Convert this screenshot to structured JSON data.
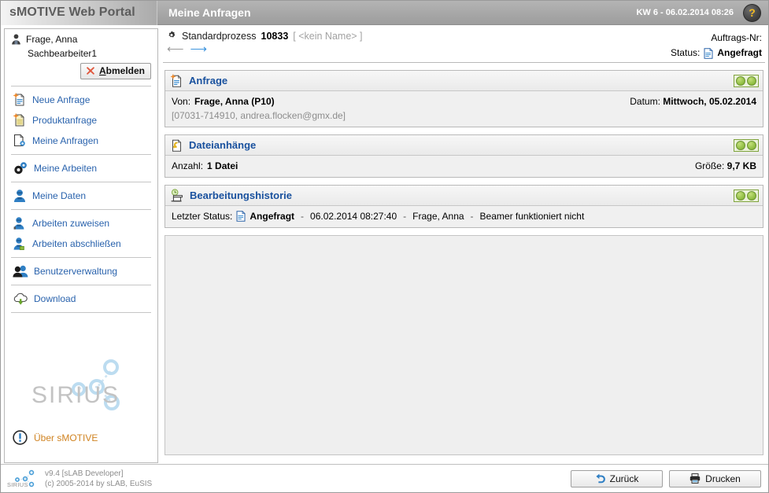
{
  "topbar": {
    "brand": "sMOTIVE Web Portal",
    "page_title": "Meine Anfragen",
    "clock": "KW 6 - 06.02.2014 08:26",
    "help_label": "?"
  },
  "sidebar": {
    "user_name": "Frage, Anna",
    "user_role": "Sachbearbeiter1",
    "logout_label": "Abmelden",
    "logout_accel": "A",
    "logout_rest": "bmelden",
    "items": [
      {
        "label": "Neue Anfrage",
        "icon": "new-document-icon"
      },
      {
        "label": "Produktanfrage",
        "icon": "product-request-icon"
      },
      {
        "label": "Meine Anfragen",
        "icon": "my-requests-icon"
      },
      {
        "label": "Meine Arbeiten",
        "icon": "gears-icon"
      },
      {
        "label": "Meine Daten",
        "icon": "user-data-icon"
      },
      {
        "label": "Arbeiten zuweisen",
        "icon": "assign-work-icon"
      },
      {
        "label": "Arbeiten abschließen",
        "icon": "complete-work-icon"
      },
      {
        "label": "Benutzerverwaltung",
        "icon": "users-icon"
      },
      {
        "label": "Download",
        "icon": "cloud-download-icon"
      }
    ],
    "watermark_text": "SIRIUS",
    "about_label": "Über sMOTIVE"
  },
  "process": {
    "type_label": "Standardprozess",
    "number": "10833",
    "name_placeholder": "[ <kein Name> ]",
    "auftrags_label": "Auftrags-Nr:",
    "auftrags_value": "",
    "status_label": "Status:",
    "status_value": "Angefragt"
  },
  "panels": [
    {
      "title": "Anfrage",
      "icon": "request-document-icon",
      "from_label": "Von:",
      "from_value": "Frage, Anna (P10)",
      "contact": "[07031-714910, andrea.flocken@gmx.de]",
      "date_label": "Datum:",
      "date_value": "Mittwoch, 05.02.2014"
    },
    {
      "title": "Dateianhänge",
      "icon": "attachment-document-icon",
      "count_label": "Anzahl:",
      "count_value": "1 Datei",
      "size_label": "Größe:",
      "size_value": "9,7 KB"
    },
    {
      "title": "Bearbeitungshistorie",
      "icon": "history-scroll-icon",
      "last_status_label": "Letzter Status:",
      "last_status_value": "Angefragt",
      "timestamp": "06.02.2014 08:27:40",
      "author": "Frage, Anna",
      "comment": "Beamer funktioniert nicht",
      "separator": "-"
    }
  ],
  "footer": {
    "version": "v9.4 [sLAB Developer]",
    "copyright": "(c) 2005-2014 by sLAB, EuSIS",
    "back_label": "Zurück",
    "print_label": "Drucken"
  },
  "colors": {
    "link": "#2a63ad",
    "panel_title": "#19519e",
    "accent_orange": "#d08321",
    "toggle_green": "#8cbb3f",
    "help_yellow": "#f2bb22"
  }
}
